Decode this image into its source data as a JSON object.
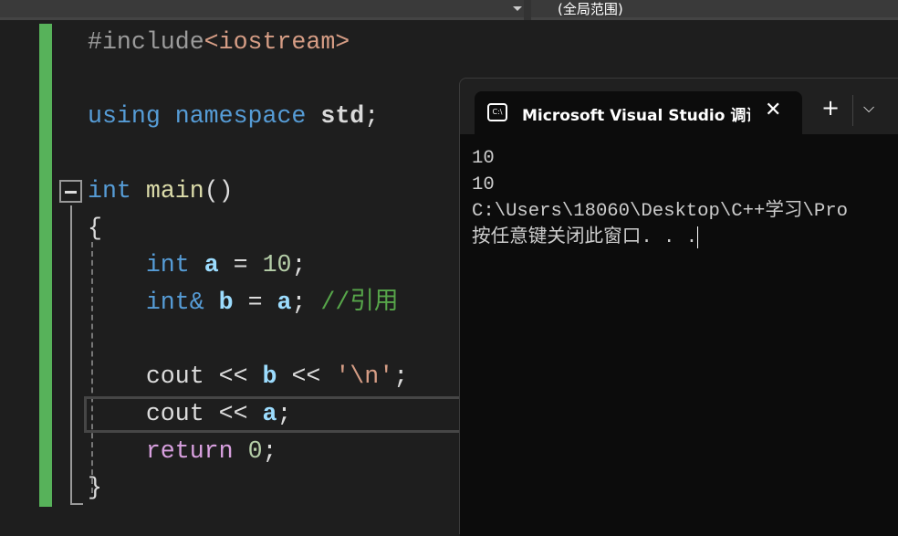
{
  "toolbar": {
    "scope": "(全局范围)"
  },
  "code": {
    "l0a": "#include",
    "l0b": "<iostream>",
    "l2a": "using",
    "l2b": "namespace",
    "l2c": "std",
    "l4a": "int",
    "l4b": "main",
    "l4c": "()",
    "l5": "{",
    "l6a": "int",
    "l6b": "a",
    "l6c": "10",
    "l7a": "int&",
    "l7b": "b",
    "l7c": "a",
    "l7d": "//引用",
    "l9a": "cout",
    "l9b": "b",
    "l9c": "'\\n'",
    "l10a": "cout",
    "l10b": "a",
    "l11a": "return",
    "l11b": "0",
    "l12": "}"
  },
  "terminal": {
    "tab_title": "Microsoft Visual Studio 调试控制台",
    "icon": "cmd-icon",
    "output": [
      "10",
      "10",
      "C:\\Users\\18060\\Desktop\\C++学习\\Pro",
      "按任意键关闭此窗口. . ."
    ]
  }
}
